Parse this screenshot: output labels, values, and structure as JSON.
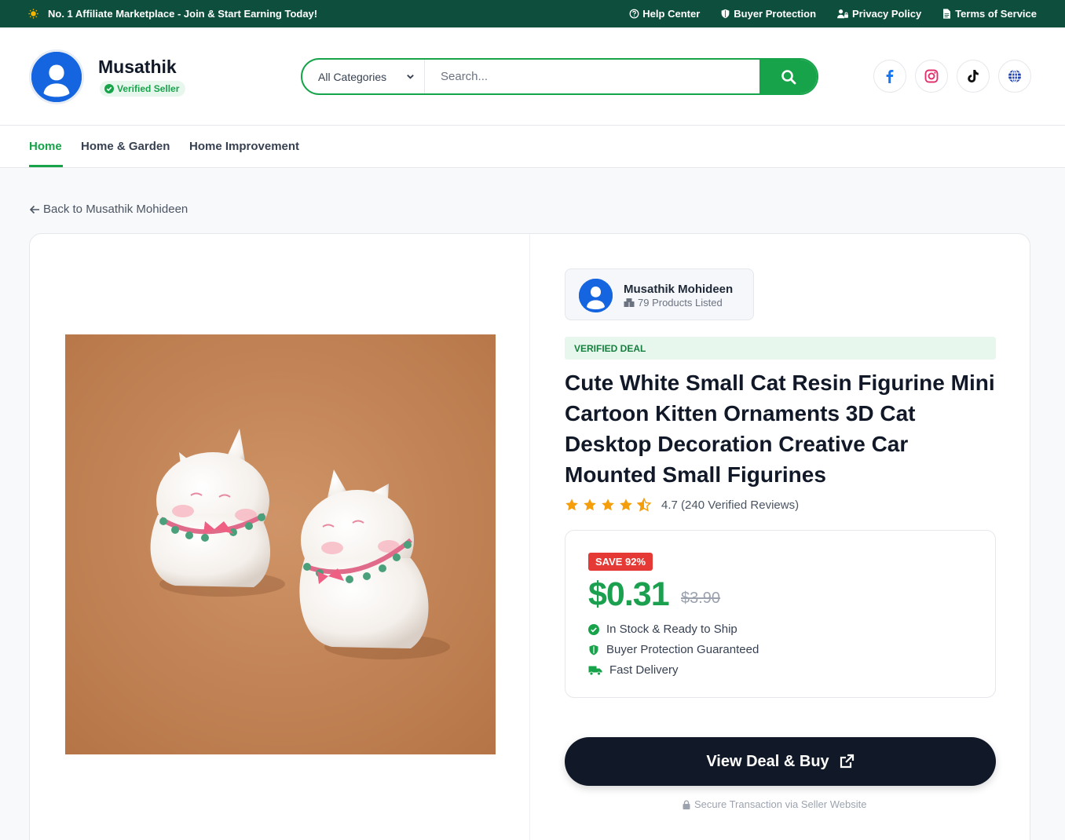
{
  "topbar": {
    "promo": "No. 1 Affiliate Marketplace - Join & Start Earning Today!",
    "links": [
      "Help Center",
      "Buyer Protection",
      "Privacy Policy",
      "Terms of Service"
    ]
  },
  "header": {
    "store_name": "Musathik",
    "verified_label": "Verified Seller",
    "category_selected": "All Categories",
    "search_placeholder": "Search...",
    "socials": [
      "facebook-icon",
      "instagram-icon",
      "tiktok-icon",
      "globe-icon"
    ]
  },
  "nav": {
    "items": [
      "Home",
      "Home & Garden",
      "Home Improvement"
    ],
    "active": "Home"
  },
  "back_link": "Back to Musathik Mohideen",
  "seller": {
    "name": "Musathik Mohideen",
    "products": "79 Products Listed"
  },
  "product": {
    "tag": "VERIFIED DEAL",
    "title": "Cute White Small Cat Resin Figurine Mini Cartoon Kitten Ornaments 3D Cat Desktop Decoration Creative Car Mounted Small Figurines",
    "rating_value": 4.7,
    "rating_text": "4.7 (240 Verified Reviews)",
    "save_label": "SAVE 92%",
    "price": "$0.31",
    "old_price": "$3.90",
    "features": [
      "In Stock & Ready to Ship",
      "Buyer Protection Guaranteed",
      "Fast Delivery"
    ],
    "cta_label": "View Deal & Buy",
    "secure_note": "Secure Transaction via Seller Website"
  },
  "colors": {
    "brand_green": "#16a34a",
    "topbar_bg": "#0d4f3c",
    "price_green": "#1aa04f",
    "save_red": "#e53935",
    "cta_dark": "#111827",
    "star_orange": "#f59e0b"
  }
}
